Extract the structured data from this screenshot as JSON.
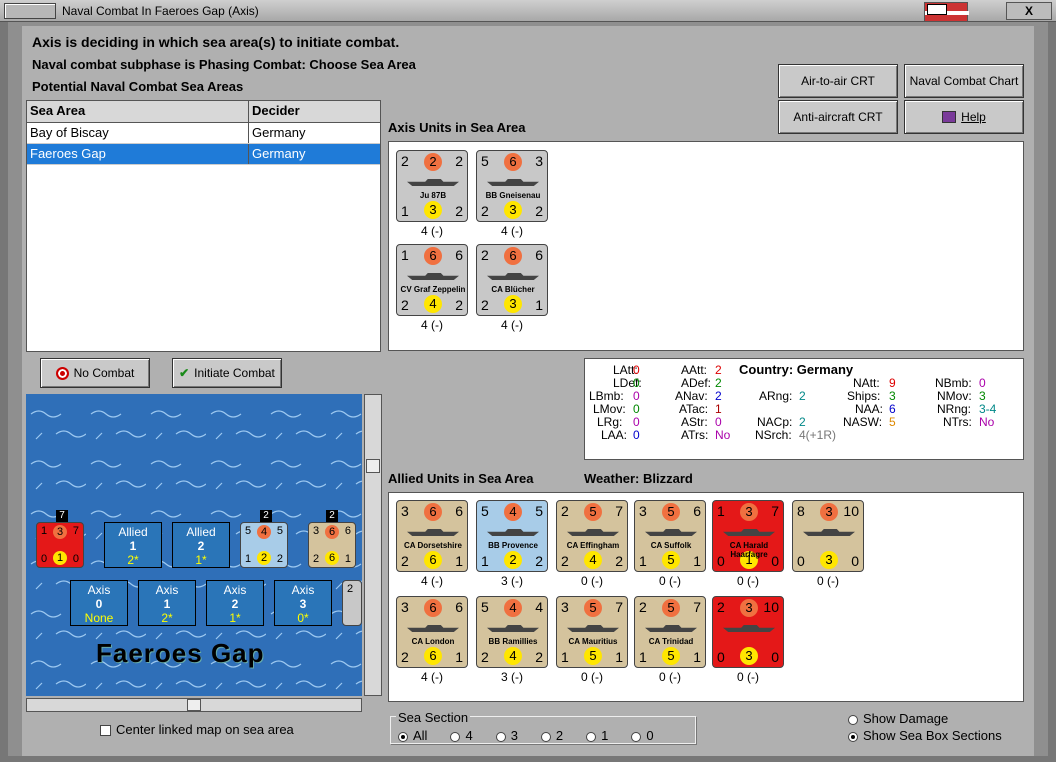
{
  "window": {
    "title": "Naval Combat In Faeroes Gap (Axis)",
    "close_label": "X"
  },
  "header": {
    "line1": "Axis is deciding in which sea area(s) to initiate combat.",
    "line2": "Naval combat subphase is Phasing Combat: Choose Sea Area",
    "line3": "Potential Naval Combat Sea Areas"
  },
  "buttons": {
    "air_crt": "Air-to-air CRT",
    "naval_chart": "Naval Combat Chart",
    "aa_crt": "Anti-aircraft CRT",
    "help": "Help",
    "no_combat": "No Combat",
    "initiate": "Initiate Combat"
  },
  "table": {
    "headers": [
      "Sea Area",
      "Decider"
    ],
    "rows": [
      {
        "area": "Bay of Biscay",
        "decider": "Germany"
      },
      {
        "area": "Faeroes Gap",
        "decider": "Germany"
      }
    ]
  },
  "axis_label": "Axis Units in Sea Area",
  "axis_units": [
    {
      "tl": "2",
      "circ": "2",
      "tr": "2",
      "name": "Ju 87B",
      "bl": "1",
      "ymid": "3",
      "br": "2",
      "stat": "4 (-)",
      "color": "gray",
      "ycirc": "2"
    },
    {
      "tl": "5",
      "circ": "6",
      "tr": "3",
      "name": "BB Gneisenau",
      "bl": "2",
      "ymid": "3",
      "br": "2",
      "stat": "4 (-)",
      "color": "gray"
    },
    {
      "tl": "1",
      "circ": "6",
      "tr": "6",
      "name": "CV Graf Zeppelin",
      "bl": "2",
      "ymid": "4",
      "br": "2",
      "stat": "4 (-)",
      "color": "gray"
    },
    {
      "tl": "2",
      "circ": "6",
      "tr": "6",
      "name": "CA Blücher",
      "bl": "2",
      "ymid": "3",
      "br": "1",
      "stat": "4 (-)",
      "color": "gray"
    }
  ],
  "info": {
    "latt": "LAtt:",
    "latt_v": "0",
    "ldef": "LDef:",
    "ldef_v": "0",
    "lbmb": "LBmb:",
    "lbmb_v": "0",
    "lmov": "LMov:",
    "lmov_v": "0",
    "lrg": "LRg:",
    "lrg_v": "0",
    "laa": "LAA:",
    "laa_v": "0",
    "aatt": "AAtt:",
    "aatt_v": "2",
    "adef": "ADef:",
    "adef_v": "2",
    "anav": "ANav:",
    "anav_v": "2",
    "atac": "ATac:",
    "atac_v": "1",
    "astr": "AStr:",
    "astr_v": "0",
    "atrs": "ATrs:",
    "atrs_v": "No",
    "country": "Country: Germany",
    "arng": "ARng:",
    "arng_v": "2",
    "nacp": "NACp:",
    "nacp_v": "2",
    "nsrch": "NSrch:",
    "nsrch_v": "4(+1R)",
    "natt": "NAtt:",
    "natt_v": "9",
    "ships": "Ships:",
    "ships_v": "3",
    "naa": "NAA:",
    "naa_v": "6",
    "nasw": "NASW:",
    "nasw_v": "5",
    "nbmb": "NBmb:",
    "nbmb_v": "0",
    "nmov": "NMov:",
    "nmov_v": "3",
    "nrng": "NRng:",
    "nrng_v": "3-4",
    "ntrs": "NTrs:",
    "ntrs_v": "No"
  },
  "allied_label": "Allied Units in Sea Area",
  "weather": "Weather:  Blizzard",
  "allied_units": [
    {
      "tl": "3",
      "circ": "6",
      "tr": "6",
      "name": "CA Dorsetshire",
      "bl": "2",
      "ymid": "6",
      "br": "1",
      "stat": "4 (-)",
      "color": "tan"
    },
    {
      "tl": "5",
      "circ": "4",
      "tr": "5",
      "name": "BB Provence",
      "bl": "1",
      "ymid": "2",
      "br": "2",
      "stat": "3 (-)",
      "color": "blue"
    },
    {
      "tl": "2",
      "circ": "5",
      "tr": "7",
      "name": "CA Effingham",
      "bl": "2",
      "ymid": "4",
      "br": "2",
      "stat": "0 (-)",
      "color": "tan"
    },
    {
      "tl": "3",
      "circ": "5",
      "tr": "6",
      "name": "CA Suffolk",
      "bl": "1",
      "ymid": "5",
      "br": "1",
      "stat": "0 (-)",
      "color": "tan"
    },
    {
      "tl": "1",
      "circ": "3",
      "tr": "7",
      "name": "CA Harald Haarfagre",
      "bl": "0",
      "ymid": "1",
      "br": "0",
      "stat": "0 (-)",
      "color": "red"
    },
    {
      "tl": "8",
      "circ": "3",
      "tr": "10",
      "name": "",
      "bl": "0",
      "ymid": "3",
      "br": "0",
      "stat": "0 (-)",
      "color": "tan"
    },
    {
      "tl": "3",
      "circ": "6",
      "tr": "6",
      "name": "CA London",
      "bl": "2",
      "ymid": "6",
      "br": "1",
      "stat": "4 (-)",
      "color": "tan"
    },
    {
      "tl": "5",
      "circ": "4",
      "tr": "4",
      "name": "BB Ramillies",
      "bl": "2",
      "ymid": "4",
      "br": "2",
      "stat": "3 (-)",
      "color": "tan"
    },
    {
      "tl": "3",
      "circ": "5",
      "tr": "7",
      "name": "CA Mauritius",
      "bl": "1",
      "ymid": "5",
      "br": "1",
      "stat": "0 (-)",
      "color": "tan"
    },
    {
      "tl": "2",
      "circ": "5",
      "tr": "7",
      "name": "CA Trinidad",
      "bl": "1",
      "ymid": "5",
      "br": "1",
      "stat": "0 (-)",
      "color": "tan"
    },
    {
      "tl": "2",
      "circ": "3",
      "tr": "10",
      "name": "",
      "bl": "0",
      "ymid": "3",
      "br": "0",
      "stat": "0 (-)",
      "color": "red"
    }
  ],
  "map": {
    "name": "Faeroes Gap",
    "allied": [
      {
        "t": "Allied",
        "n": "1",
        "s": "2*"
      },
      {
        "t": "Allied",
        "n": "2",
        "s": "1*"
      }
    ],
    "axis": [
      {
        "t": "Axis",
        "n": "0",
        "s": "None"
      },
      {
        "t": "Axis",
        "n": "1",
        "s": "2*"
      },
      {
        "t": "Axis",
        "n": "2",
        "s": "1*"
      },
      {
        "t": "Axis",
        "n": "3",
        "s": "0*"
      }
    ],
    "stack_counts": [
      "7",
      "2",
      "2"
    ]
  },
  "center_linked": "Center linked map on sea area",
  "sea_section": {
    "label": "Sea Section",
    "options": [
      "All",
      "4",
      "3",
      "2",
      "1",
      "0"
    ]
  },
  "show_damage": "Show Damage",
  "show_boxes": "Show Sea Box Sections"
}
